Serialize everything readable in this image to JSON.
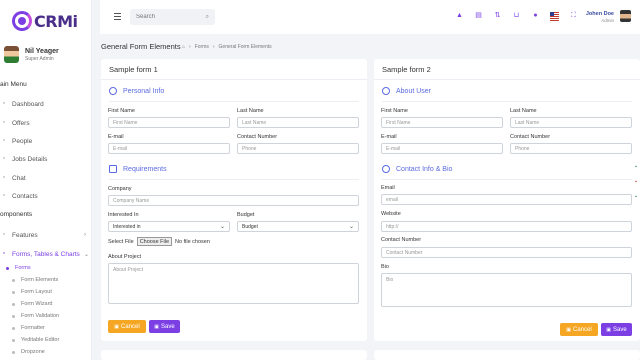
{
  "app": {
    "logo_text": "CRMi"
  },
  "sidebar": {
    "user_name": "Nil Yeager",
    "user_role": "Super Admin",
    "main_menu_heading": "ain Menu",
    "items": [
      {
        "label": "Dashboard",
        "icon": "dashboard-icon"
      },
      {
        "label": "Offers",
        "icon": "offers-icon"
      },
      {
        "label": "People",
        "icon": "people-icon"
      },
      {
        "label": "Jobs Details",
        "icon": "jobs-icon"
      },
      {
        "label": "Chat",
        "icon": "chat-icon"
      },
      {
        "label": "Contacts",
        "icon": "contacts-icon"
      }
    ],
    "components_heading": "omponents",
    "features_label": "Features",
    "forms_group_label": "Forms, Tables & Charts",
    "forms_label": "Forms",
    "sub_items": [
      "Form Elements",
      "Form Layout",
      "Form Wizard",
      "Form Validation",
      "Formatter",
      "Yeditable Editor",
      "Dropzone"
    ]
  },
  "topbar": {
    "search_placeholder": "Search",
    "user_name": "Johen Doe",
    "user_role": "Admin"
  },
  "page": {
    "title": "General Form Elements",
    "breadcrumb": [
      "Forms",
      "General Form Elements"
    ]
  },
  "form1": {
    "title": "Sample form 1",
    "section1": "Personal Info",
    "first_name_label": "First Name",
    "first_name_placeholder": "First Name",
    "last_name_label": "Last Name",
    "last_name_placeholder": "Last Name",
    "email_label": "E-mail",
    "email_placeholder": "E-mail",
    "contact_label": "Contact Number",
    "contact_placeholder": "Phone",
    "section2": "Requirements",
    "company_label": "Company",
    "company_placeholder": "Company Name",
    "interested_label": "Interested In",
    "interested_value": "Interested in",
    "budget_label": "Budget",
    "budget_value": "Budget",
    "select_file_label": "Select File",
    "choose_file_button": "Choose File",
    "no_file_text": "No file chosen",
    "about_label": "About Project",
    "about_placeholder": "About Project",
    "cancel_label": "Cancel",
    "save_label": "Save"
  },
  "form2": {
    "title": "Sample form 2",
    "section1": "About User",
    "first_name_label": "First Name",
    "first_name_placeholder": "First Name",
    "last_name_label": "Last Name",
    "last_name_placeholder": "Last Name",
    "email_label": "E-mail",
    "email_placeholder": "E-mail",
    "contact_label": "Contact Number",
    "contact_placeholder": "Phone",
    "section2": "Contact Info & Bio",
    "email2_label": "Email",
    "email2_placeholder": "email",
    "website_label": "Website",
    "website_placeholder": "http://",
    "contact2_label": "Contact Number",
    "contact2_placeholder": "Contact Number",
    "bio_label": "Bio",
    "bio_placeholder": "Bio",
    "cancel_label": "Cancel",
    "save_label": "Save"
  },
  "colors": {
    "accent": "#7b3fe4",
    "section": "#5b6be0",
    "cancel": "#f5a623"
  }
}
